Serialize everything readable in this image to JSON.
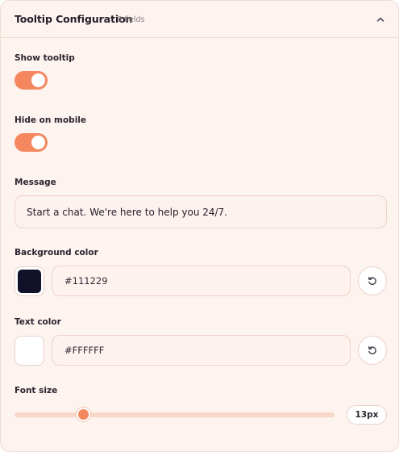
{
  "panel": {
    "title": "Tooltip Configuration",
    "field_count": "6 fields",
    "collapse_icon": "chevron-up-icon"
  },
  "show_tooltip": {
    "label": "Show tooltip",
    "on": true
  },
  "hide_on_mobile": {
    "label": "Hide on mobile",
    "on": true
  },
  "message": {
    "label": "Message",
    "value": "Start a chat. We're here to help you 24/7."
  },
  "background_color": {
    "label": "Background color",
    "value": "#111229",
    "swatch": "#111229",
    "reset_icon": "reset-icon"
  },
  "text_color": {
    "label": "Text color",
    "value": "#FFFFFF",
    "swatch": "#FFFFFF",
    "reset_icon": "reset-icon"
  },
  "font_size": {
    "label": "Font size",
    "value_label": "13px",
    "value": 13,
    "min": 10,
    "max": 24
  },
  "colors": {
    "accent": "#F5875F",
    "panel_bg": "#FDF3EF",
    "border": "#F1DCD4"
  }
}
